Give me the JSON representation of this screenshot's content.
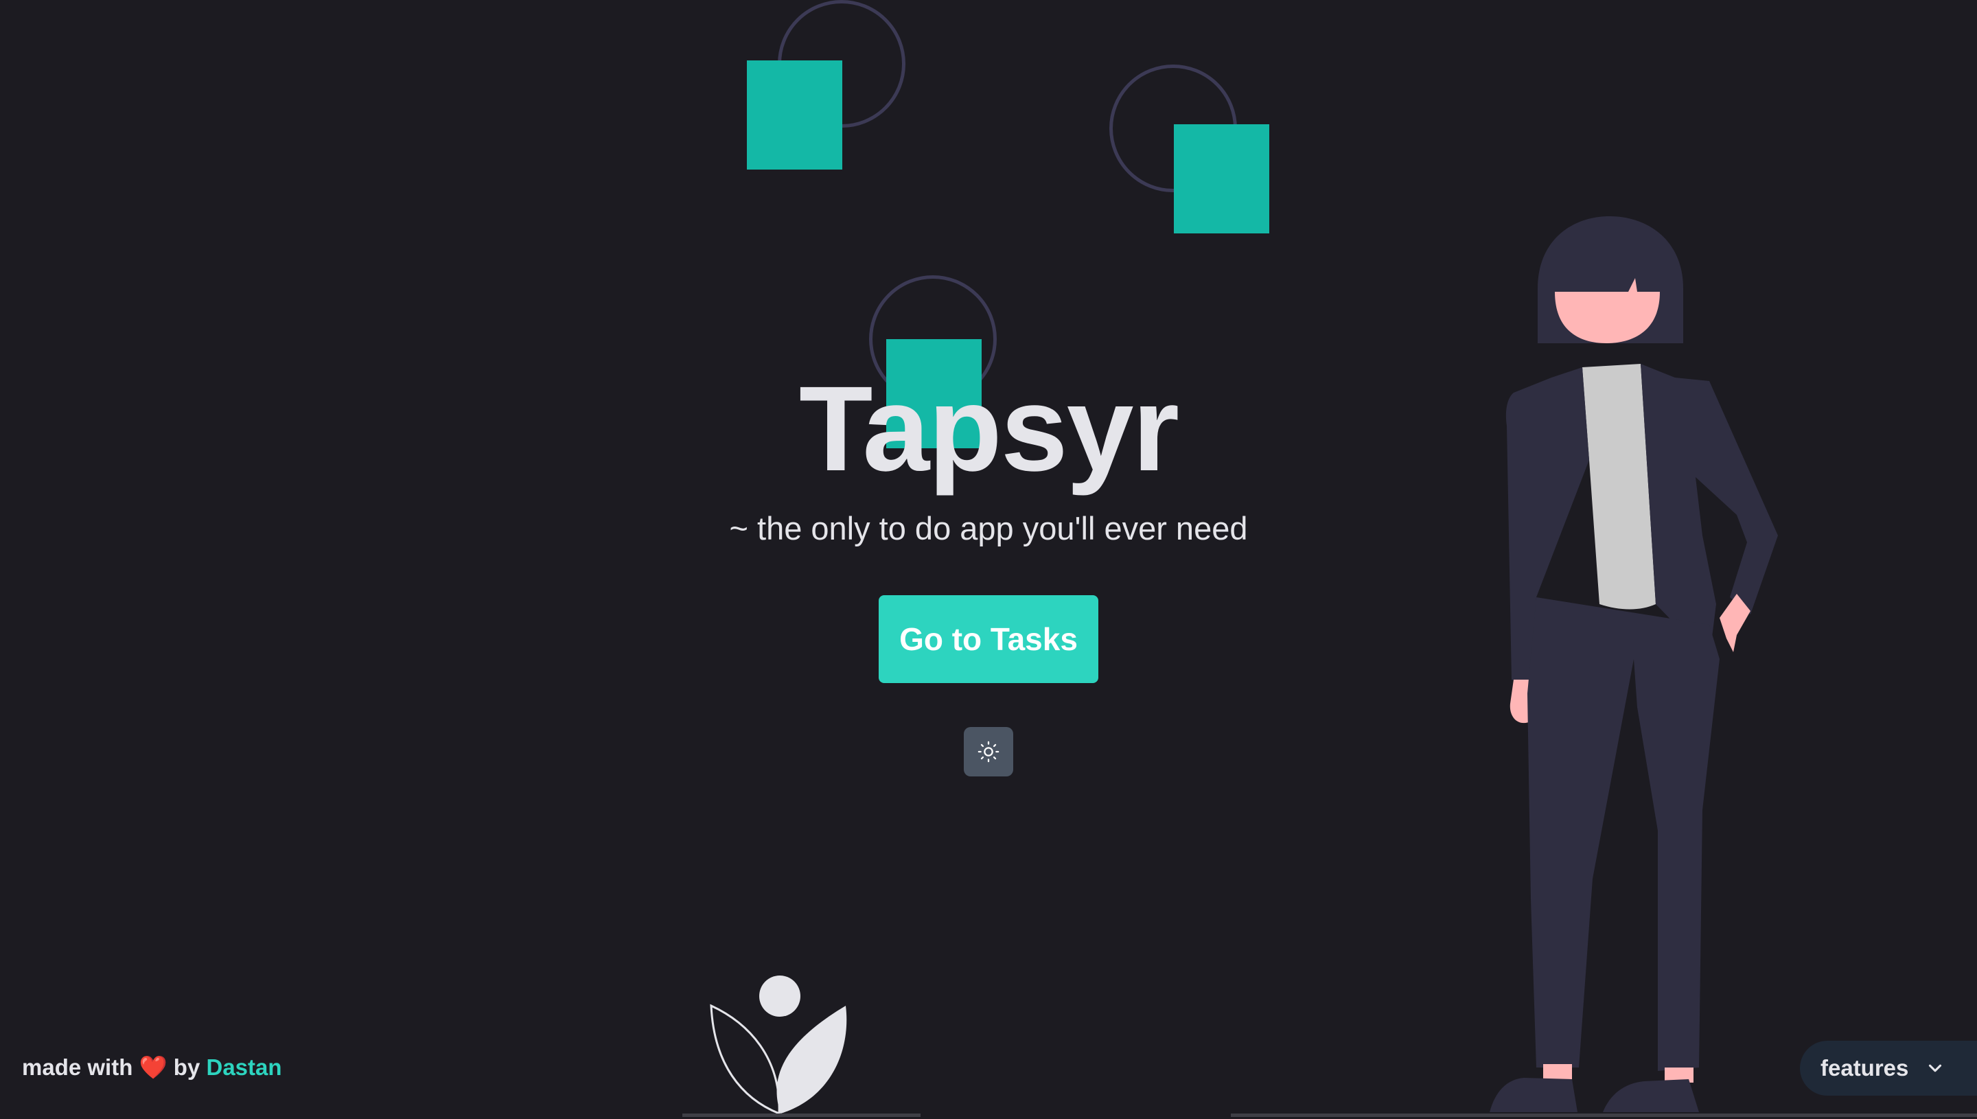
{
  "app": {
    "title": "Tapsyr",
    "tagline": "~ the only to do app you'll ever need"
  },
  "actions": {
    "cta_label": "Go to Tasks",
    "theme_toggle_icon": "sun-icon"
  },
  "footer": {
    "credit_prefix": "made with",
    "heart": "❤️",
    "credit_by": "by",
    "author": "Dastan",
    "features_label": "features",
    "features_icon": "chevron-down-icon"
  },
  "colors": {
    "background": "#1c1b21",
    "accent": "#2dd4bf",
    "accent_dark": "#14b8a6",
    "text": "#e5e5ea",
    "toggle_bg": "#4b5563",
    "features_bg": "#1f2937"
  }
}
